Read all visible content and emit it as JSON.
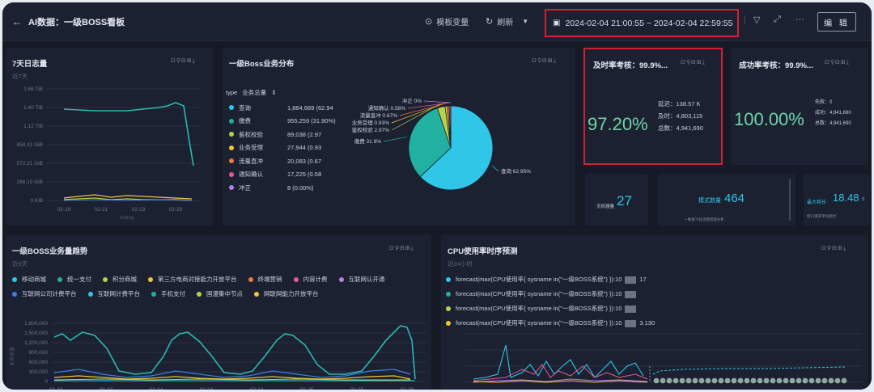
{
  "header": {
    "title": "AI数据：一级BOSS看板",
    "template_vars": "模板变量",
    "refresh": "刷新",
    "time_range": "2024-02-04 21:00:55 ~ 2024-02-04 22:59:55",
    "edit": "编 辑"
  },
  "panels": {
    "log_volume": {
      "title": "7天日志量",
      "subtitle": "近7天",
      "y_ticks": [
        "1.68 TiB",
        "1.40 TiB",
        "1.12 TiB",
        "858.31 GiB",
        "572.21 GiB",
        "286.10 GiB",
        "0 KiB"
      ],
      "x_ticks": [
        "02-19",
        "02-21",
        "02-23",
        "02-25"
      ],
      "x_label": "timing"
    },
    "boss_dist": {
      "title": "一级Boss业务分布",
      "legend_header_type": "type",
      "legend_header_value": "业务总量",
      "legend": [
        {
          "name": "查询",
          "value": "1,884,689 (62.94",
          "color": "#2fc6e8"
        },
        {
          "name": "缴费",
          "value": "955,259 (31.90%)",
          "color": "#22b0a0"
        },
        {
          "name": "鉴权校验",
          "value": "89,038 (2.97",
          "color": "#b8d24a"
        },
        {
          "name": "业务受理",
          "value": "27,944 (0.93",
          "color": "#f0c53c"
        },
        {
          "name": "流量直冲",
          "value": "20,083 (0.67",
          "color": "#ee7a3c"
        },
        {
          "name": "通知确认",
          "value": "17,225 (0.58",
          "color": "#e8589a"
        },
        {
          "name": "冲正",
          "value": "8 (0.00%)",
          "color": "#b780e6"
        }
      ],
      "pie": [
        {
          "name": "查询",
          "value": 62.95,
          "label": "查询  62.95%",
          "color": "#2fc6e8"
        },
        {
          "name": "缴费",
          "value": 31.9,
          "label": "缴费  31.9%",
          "color": "#22b0a0"
        },
        {
          "name": "鉴权校验",
          "value": 2.97,
          "label": "鉴权校验  2.97%",
          "color": "#b8d24a"
        },
        {
          "name": "业务受理",
          "value": 0.93,
          "label": "业务受理  0.93%",
          "color": "#f0c53c"
        },
        {
          "name": "流量直冲",
          "value": 0.67,
          "label": "流量直冲  0.67%",
          "color": "#ee7a3c"
        },
        {
          "name": "通知确认",
          "value": 0.58,
          "label": "通知确认  0.58%",
          "color": "#e8589a"
        },
        {
          "name": "冲正",
          "value": 0.0,
          "label": "冲正  0%",
          "color": "#b780e6"
        }
      ]
    },
    "timeliness": {
      "title": "及时率考核：99.9%...",
      "value": "97.20%",
      "delay": "延迟：138.57 K",
      "on_time": "及时：4,803,115",
      "total": "总数：4,941,690"
    },
    "success": {
      "title": "成功率考核：99.9%...",
      "value": "100.00%",
      "fail": "失败：0",
      "ok": "成功：4,941,690",
      "total": "总数：4,941,690"
    },
    "small1": {
      "label": "无机器量",
      "value": "27"
    },
    "small2": {
      "label": "模式数量",
      "value": "464",
      "note": "• 数据下钻功能智能分析"
    },
    "small3": {
      "label": "最大耗长",
      "value": "18.48",
      "unit": "s",
      "note": "接口请求平均耗时"
    },
    "trend": {
      "title": "一级BOSS业务量趋势",
      "subtitle": "近5天",
      "legend": [
        {
          "name": "移动商城",
          "color": "#2fc6e8"
        },
        {
          "name": "统一支付",
          "color": "#22b0a0"
        },
        {
          "name": "积分商城",
          "color": "#b8d24a"
        },
        {
          "name": "第三方电商对接能力开放平台",
          "color": "#f0c53c"
        },
        {
          "name": "终端营销",
          "color": "#ee7a3c"
        },
        {
          "name": "内容计费",
          "color": "#e8589a"
        },
        {
          "name": "互联网认开通",
          "color": "#b780e6"
        },
        {
          "name": "互联网公司计费平台",
          "color": "#3d7ee8"
        },
        {
          "name": "互联网计费平台",
          "color": "#2fc6e8"
        },
        {
          "name": "手机支付",
          "color": "#22b0a0"
        },
        {
          "name": "国漫集中节点",
          "color": "#b8d24a"
        },
        {
          "name": "网联网能力开放平台",
          "color": "#f0c53c"
        }
      ],
      "y_ticks": [
        "1,800,000",
        "1,500,000",
        "1,200,000",
        "900,000",
        "600,000",
        "300,000",
        "0"
      ],
      "x_ticks": [
        "02-23",
        "02-23",
        "02-24",
        "02-24",
        "02-24",
        "02-25",
        "02-25",
        "02-26"
      ],
      "y_label": "业务总量"
    },
    "cpu": {
      "title": "CPU使用率时序预测",
      "subtitle": "近24小时",
      "legend": [
        {
          "text": "forecast(max(CPU使用率{ sysname in(\"一级BOSS系统\") }):10",
          "suffix": "17",
          "color": "#2fc6e8"
        },
        {
          "text": "forecast(max(CPU使用率{ sysname in(\"一级BOSS系统\") }):10",
          "suffix": "",
          "color": "#22b0a0"
        },
        {
          "text": "forecast(max(CPU使用率{ sysname in(\"一级BOSS系统\") }):10",
          "suffix": "",
          "color": "#b8d24a"
        },
        {
          "text": "forecast(max(CPU使用率{ sysname in(\"一级BOSS系统\") }):10",
          "suffix": "3.130",
          "color": "#f0c53c"
        }
      ]
    }
  }
}
